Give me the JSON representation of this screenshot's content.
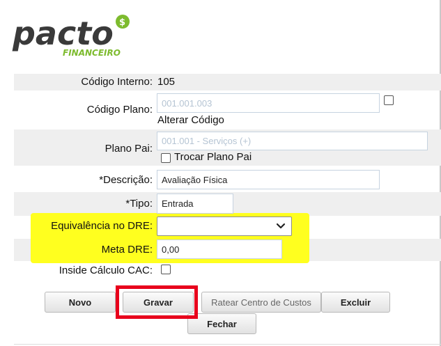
{
  "logo": {
    "brand": "pacto",
    "badge": "$",
    "subtitle": "FINANCEIRO"
  },
  "form": {
    "codigo_interno": {
      "label": "Código Interno:",
      "value": "105"
    },
    "codigo_plano": {
      "label": "Código Plano:",
      "placeholder": "001.001.003",
      "alterar_label": "Alterar Código"
    },
    "plano_pai": {
      "label": "Plano Pai:",
      "placeholder": "001.001 - Serviços (+)",
      "trocar_label": "Trocar Plano Pai"
    },
    "descricao": {
      "label": "*Descrição:",
      "value": "Avaliação Física"
    },
    "tipo": {
      "label": "*Tipo:",
      "value": "Entrada"
    },
    "equivalencia": {
      "label": "Equivalência no DRE:",
      "value": ""
    },
    "meta": {
      "label": "Meta DRE:",
      "value": "0,00"
    },
    "inside": {
      "label": "Inside Cálculo CAC:"
    }
  },
  "buttons": {
    "novo": "Novo",
    "gravar": "Gravar",
    "ratear": "Ratear Centro de Custos",
    "excluir": "Excluir",
    "fechar": "Fechar"
  },
  "colors": {
    "highlight": "#ffff1f",
    "annotation_box": "#e8001c",
    "logo_dark": "#3a3a3a",
    "logo_green": "#7dbb2e"
  }
}
